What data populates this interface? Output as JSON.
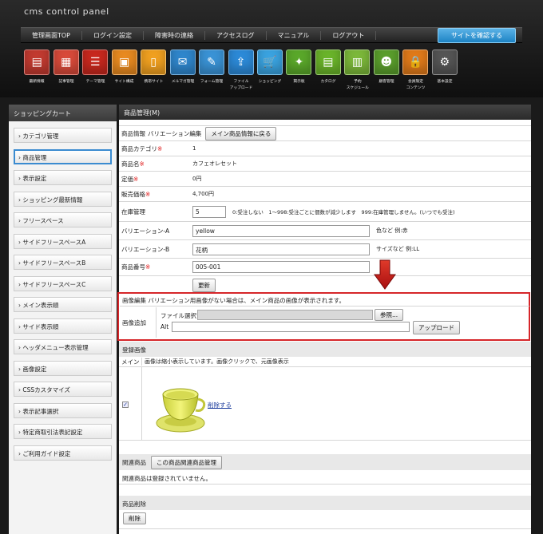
{
  "brand": "cms control panel",
  "nav": {
    "items": [
      "管理画面TOP",
      "ログイン設定",
      "障害時の連絡",
      "アクセスログ",
      "マニュアル",
      "ログアウト"
    ],
    "confirm": "サイトを確認する"
  },
  "icons": [
    {
      "label": "最新情報",
      "icon": "news-icon",
      "color": "#c23a30",
      "glyph": "▤"
    },
    {
      "label": "記事管理",
      "icon": "articles-icon",
      "color": "#d84a3a",
      "glyph": "▦"
    },
    {
      "label": "テーマ管理",
      "icon": "theme-icon",
      "color": "#c8281e",
      "glyph": "☰"
    },
    {
      "label": "サイト構成",
      "icon": "site-structure-icon",
      "color": "#e88a20",
      "glyph": "▣"
    },
    {
      "label": "携帯サイト",
      "icon": "mobile-site-icon",
      "color": "#f0a020",
      "glyph": "▯"
    },
    {
      "label": "メルマガ管理",
      "icon": "newsletter-icon",
      "color": "#2f86cc",
      "glyph": "✉"
    },
    {
      "label": "フォーム管理",
      "icon": "form-icon",
      "color": "#3a93d6",
      "glyph": "✎"
    },
    {
      "label": "ファイル\nアップロード",
      "icon": "file-upload-icon",
      "color": "#2c8ad8",
      "glyph": "⇪"
    },
    {
      "label": "ショッピング",
      "icon": "shopping-icon",
      "color": "#3aa3e0",
      "glyph": "🛒"
    },
    {
      "label": "掲示板",
      "icon": "bbs-icon",
      "color": "#5aa82a",
      "glyph": "✦"
    },
    {
      "label": "カタログ",
      "icon": "catalog-icon",
      "color": "#6ab42a",
      "glyph": "▤"
    },
    {
      "label": "予約\nスケジュール",
      "icon": "schedule-icon",
      "color": "#7cb83a",
      "glyph": "▥"
    },
    {
      "label": "顧客管理",
      "icon": "customer-icon",
      "color": "#5a9e2c",
      "glyph": "☻"
    },
    {
      "label": "会員限定\nコンテンツ",
      "icon": "members-icon",
      "color": "#e07a1a",
      "glyph": "🔒"
    },
    {
      "label": "基本設定",
      "icon": "gear-icon",
      "color": "#555555",
      "glyph": "⚙"
    }
  ],
  "sidebar": {
    "title": "ショッピングカート",
    "items": [
      "カテゴリ管理",
      "商品管理",
      "表示設定",
      "ショッピング最新情報",
      "フリースペース",
      "サイドフリースペースA",
      "サイドフリースペースB",
      "サイドフリースペースC",
      "メイン表示順",
      "サイド表示順",
      "ヘッダメニュー表示管理",
      "画像設定",
      "CSSカスタマイズ",
      "表示記事選択",
      "特定商取引法表記設定",
      "ご利用ガイド設定"
    ],
    "active_index": 1
  },
  "main": {
    "title": "商品管理(M)",
    "info_label": "商品情報",
    "variation_label": "バリエーション編集",
    "back_button": "メイン商品情報に戻る",
    "rows": {
      "category": {
        "label": "商品カテゴリ",
        "req": "※",
        "value": "1"
      },
      "name": {
        "label": "商品名",
        "req": "※",
        "value": "カフェオレセット"
      },
      "list_price": {
        "label": "定価",
        "req": "※",
        "value": "0円"
      },
      "sale_price": {
        "label": "販売価格",
        "req": "※",
        "value": "4,700円"
      },
      "stock": {
        "label": "在庫管理",
        "value": "5",
        "hint": "0:受注しない　1〜998:受注ごとに個数が減少します　999:在庫管理しません。(いつでも受注)"
      },
      "variation_a": {
        "label": "バリエーション-A",
        "value": "yellow",
        "hint": "色など 例:赤"
      },
      "variation_b": {
        "label": "バリエーション-B",
        "value": "花柄",
        "hint": "サイズなど 例:LL"
      },
      "product_no": {
        "label": "商品番号",
        "req": "※",
        "value": "005-001"
      }
    },
    "update_button": "更新",
    "image_edit": {
      "title": "画像編集",
      "note": "バリエーション用画像がない場合は、メイン商品の画像が表示されます。",
      "add_label": "画像追加",
      "file_label": "ファイル選択",
      "browse_button": "参照...",
      "alt_label": "Alt",
      "upload_button": "アップロード"
    },
    "registered": {
      "title": "登録画像",
      "main_label": "メイン",
      "note": "画像は縮小表示しています。画像クリックで、元画像表示",
      "delete_link": "削除する"
    },
    "related": {
      "label": "関連商品",
      "button": "この商品関連商品管理",
      "empty": "関連商品は登録されていません。"
    },
    "delete": {
      "label": "商品削除",
      "button": "削除"
    }
  }
}
